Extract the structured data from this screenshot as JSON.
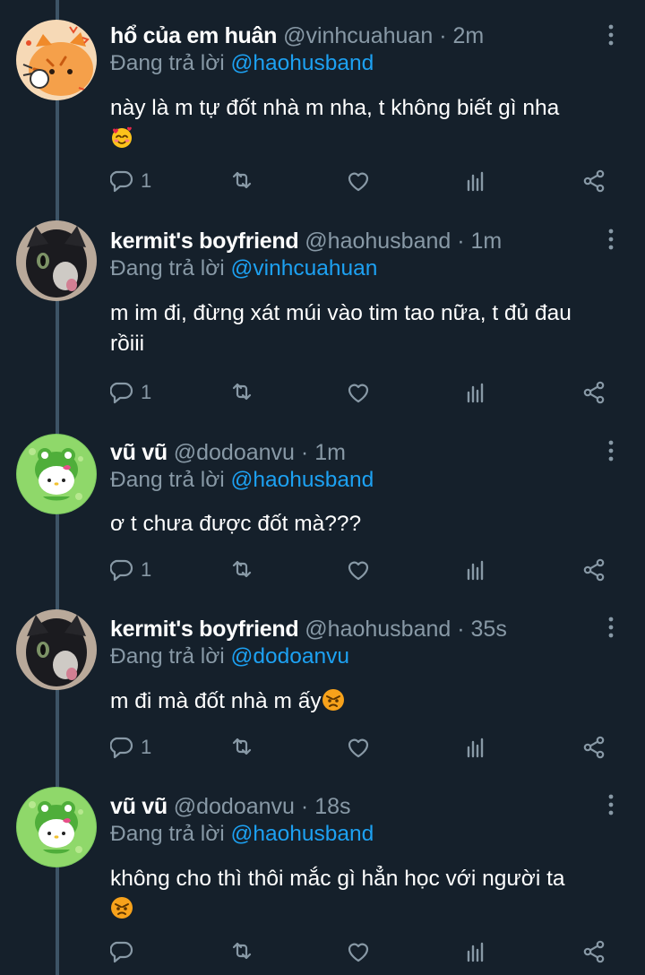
{
  "reply_prefix": "Đang trả lời",
  "tweets": [
    {
      "name": "hổ của em huân",
      "handle": "@vinhcuahuan",
      "time": "2m",
      "reply_to": "@haohusband",
      "text_line1": "này là m tự đốt nhà m nha, t không biết gì nha",
      "text_line2": "",
      "emoji": "smiling-face-with-hearts",
      "reply_count": "1",
      "avatar": "tiger-cat-avatar"
    },
    {
      "name": "kermit's boyfriend",
      "handle": "@haohusband",
      "time": "1m",
      "reply_to": "@vinhcuahuan",
      "text_line1": "m im đi, đừng xát múi vào tim tao nữa, t đủ đau",
      "text_line2": "rồiii",
      "emoji": "",
      "reply_count": "1",
      "avatar": "black-cat-avatar"
    },
    {
      "name": "vũ vũ",
      "handle": "@dodoanvu",
      "time": "1m",
      "reply_to": "@haohusband",
      "text_line1": "ơ t chưa được đốt mà???",
      "text_line2": "",
      "emoji": "",
      "reply_count": "1",
      "avatar": "hello-kitty-frog-avatar"
    },
    {
      "name": "kermit's boyfriend",
      "handle": "@haohusband",
      "time": "35s",
      "reply_to": "@dodoanvu",
      "text_line1": "m đi mà đốt nhà m ấy",
      "text_line2": "",
      "emoji": "angry-face",
      "reply_count": "1",
      "avatar": "black-cat-avatar"
    },
    {
      "name": "vũ vũ",
      "handle": "@dodoanvu",
      "time": "18s",
      "reply_to": "@haohusband",
      "text_line1": "không cho thì thôi mắc gì hẳn học với người ta",
      "text_line2": "",
      "emoji": "angry-face",
      "reply_count": "",
      "avatar": "hello-kitty-frog-avatar"
    }
  ],
  "colors": {
    "background": "#15202b",
    "text": "#ffffff",
    "muted": "#8899a6",
    "link": "#1da1f2",
    "thread_line": "#3d5466"
  }
}
